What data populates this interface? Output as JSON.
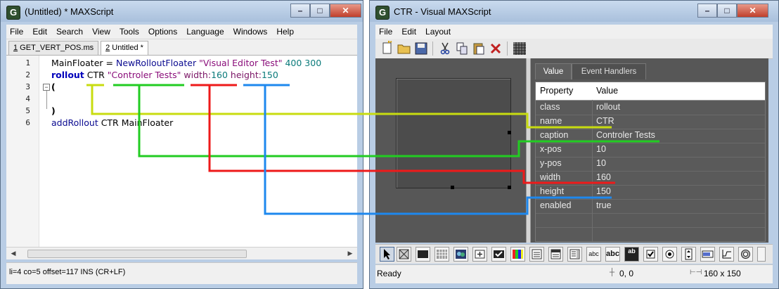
{
  "left_window": {
    "title": "(Untitled) * MAXScript",
    "app_icon": "G",
    "menu": [
      "File",
      "Edit",
      "Search",
      "View",
      "Tools",
      "Options",
      "Language",
      "Windows",
      "Help"
    ],
    "tabs": [
      {
        "num": "1",
        "label": " GET_VERT_POS.ms"
      },
      {
        "num": "2",
        "label": " Untitled *"
      }
    ],
    "line_numbers": [
      "1",
      "2",
      "3",
      "4",
      "5",
      "6"
    ],
    "code": {
      "line1": {
        "a": "MainFloater = ",
        "b": "NewRolloutFloater",
        "c": " ",
        "d": "\"Visual Editor Test\"",
        "e": " 400 300"
      },
      "line2": {
        "a": "rollout",
        "b": " CTR ",
        "c": "\"Controler Tests\"",
        "d": " width:",
        "e": "160",
        "f": " height:",
        "g": "150"
      },
      "line3": "(",
      "line5": ")",
      "line6": {
        "a": "addRollout",
        "b": " CTR MainFloater"
      }
    },
    "status": "li=4 co=5 offset=117 INS (CR+LF)"
  },
  "right_window": {
    "title": "CTR - Visual MAXScript",
    "app_icon": "G",
    "menu": [
      "File",
      "Edit",
      "Layout"
    ],
    "property_tabs": [
      "Value",
      "Event Handlers"
    ],
    "grid_header": {
      "property": "Property",
      "value": "Value"
    },
    "properties": [
      {
        "name": "class",
        "value": "rollout"
      },
      {
        "name": "name",
        "value": "CTR"
      },
      {
        "name": "caption",
        "value": "Controler Tests"
      },
      {
        "name": "x-pos",
        "value": "10"
      },
      {
        "name": "y-pos",
        "value": "10"
      },
      {
        "name": "width",
        "value": "160"
      },
      {
        "name": "height",
        "value": "150"
      },
      {
        "name": "enabled",
        "value": "true"
      }
    ],
    "palette_labels": {
      "abc": "abc",
      "abc_bold": "abc",
      "ab": "ab"
    },
    "status": {
      "ready": "Ready",
      "position": "0, 0",
      "size": "160 x 150"
    }
  },
  "window_controls": {
    "minimize": "–",
    "maximize": "□",
    "close": "✕"
  },
  "colors": {
    "yellow_line": "#c8dc10",
    "green_line": "#22cc22",
    "red_line": "#ee1a1a",
    "blue_line": "#1e88ee"
  }
}
